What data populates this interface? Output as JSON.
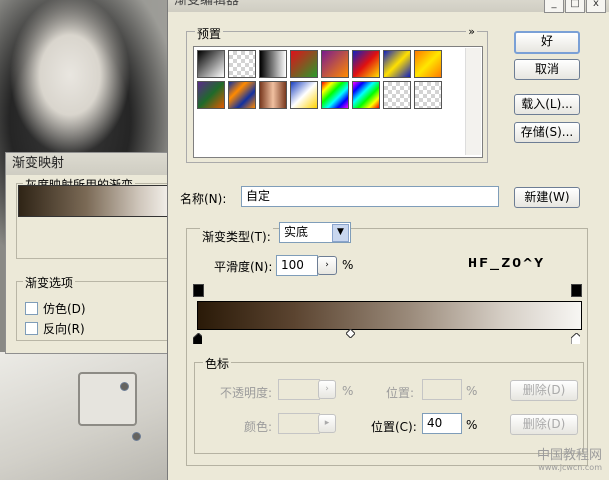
{
  "editor": {
    "title": "渐变编辑器",
    "win_buttons": [
      "_",
      "□",
      "x"
    ],
    "presets_label": "预置",
    "presets_menu": "»",
    "ok_label": "好",
    "cancel_label": "取消",
    "load_label": "载入(L)...",
    "save_label": "存储(S)...",
    "name_label": "名称(N):",
    "name_value": "自定",
    "new_label": "新建(W)",
    "type_label": "渐变类型(T):",
    "type_value": "实底",
    "smooth_label": "平滑度(N):",
    "smooth_value": "100",
    "percent": "%",
    "stops_group": "色标",
    "opacity_label": "不透明度:",
    "location_label": "位置:",
    "location2_label": "位置(C):",
    "location2_value": "40",
    "delete_label": "删除(D)",
    "color_label": "颜色:",
    "logo": "HF_ZO^Y",
    "watermark": "中国教程网",
    "watermark_url": "www.jcwcn.com"
  },
  "gradient_map": {
    "title": "渐变映射",
    "group_label": "灰度映射所用的渐变",
    "options_label": "渐变选项",
    "dither_label": "仿色(D)",
    "reverse_label": "反向(R)"
  },
  "colors": {
    "accent_border": "#7aa0d6",
    "gradient_dark": "#2a1a08",
    "gradient_light": "#f7f6f3"
  }
}
